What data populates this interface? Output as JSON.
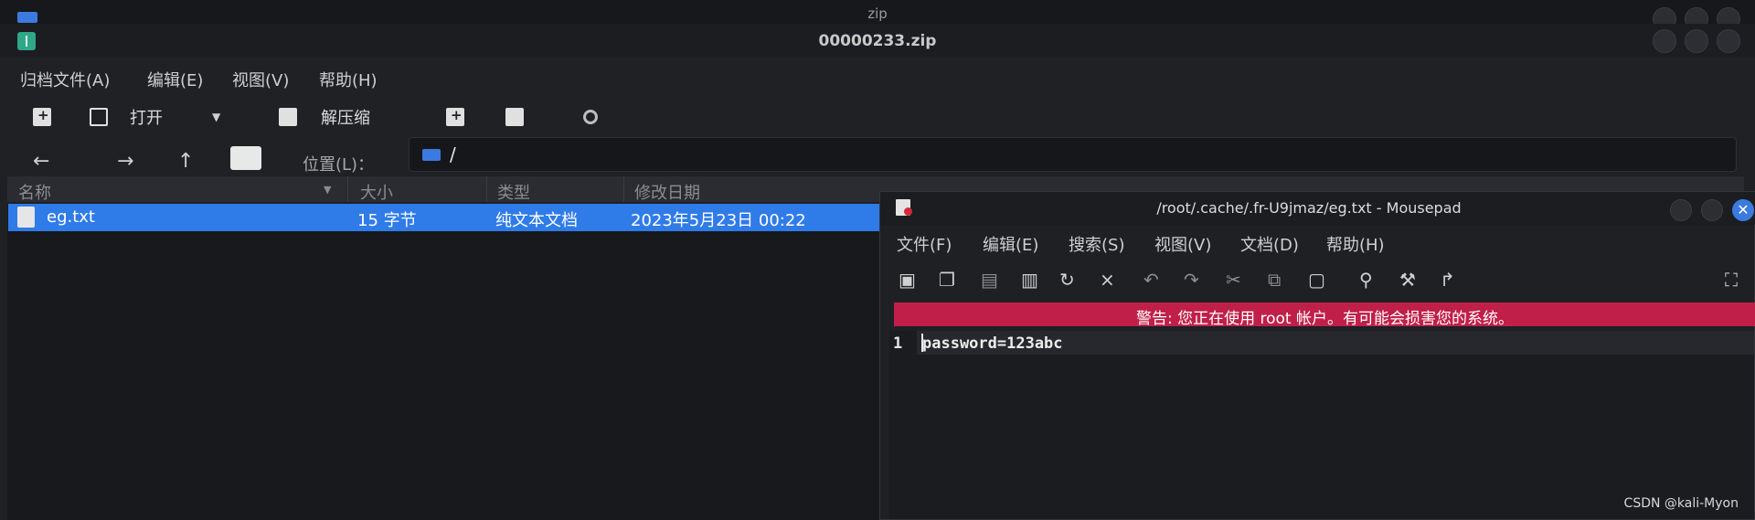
{
  "bg_window": {
    "title": "zip"
  },
  "archive": {
    "title": "00000233.zip",
    "menu": [
      "归档文件(A)",
      "编辑(E)",
      "视图(V)",
      "帮助(H)"
    ],
    "toolbar": {
      "open_label": "打开",
      "extract_label": "解压缩"
    },
    "location_label": "位置(L)：",
    "location_path": "/",
    "columns": [
      "名称",
      "大小",
      "类型",
      "修改日期"
    ],
    "rows": [
      {
        "name": "eg.txt",
        "size": "15 字节",
        "type": "纯文本文档",
        "modified": "2023年5月23日 00:22"
      }
    ]
  },
  "mousepad": {
    "title": "/root/.cache/.fr-U9jmaz/eg.txt - Mousepad",
    "menu": [
      "文件(F)",
      "编辑(E)",
      "搜索(S)",
      "视图(V)",
      "文档(D)",
      "帮助(H)"
    ],
    "warning": "警告: 您正在使用 root 帐户。有可能会损害您的系统。",
    "line_number": "1",
    "content": "password=123abc",
    "close_glyph": "✕"
  },
  "watermark": "CSDN @kali-Myon",
  "colors": {
    "accent": "#2f7be8",
    "warning": "#c01f49"
  }
}
